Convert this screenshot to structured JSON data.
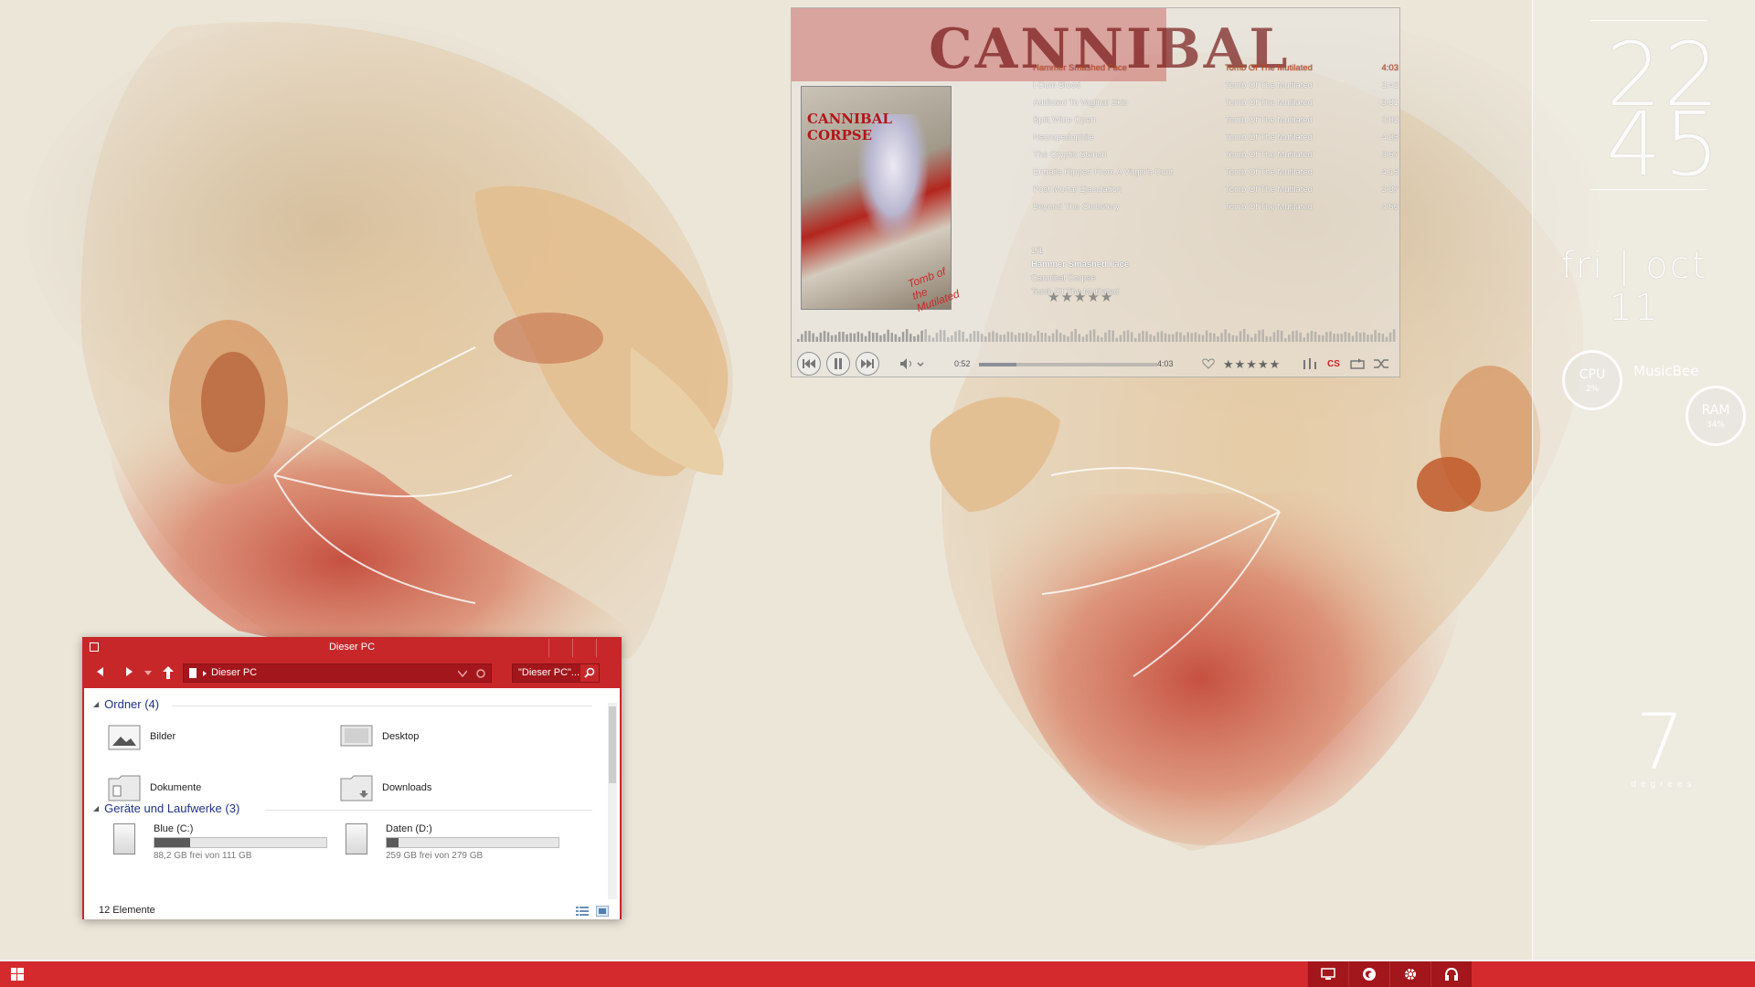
{
  "desktop": {
    "clock": {
      "hour": "22",
      "minute": "45"
    },
    "date": "fri | oct 11",
    "cpu": {
      "label": "CPU",
      "value": "2%"
    },
    "ram": {
      "label": "RAM",
      "value": "34%"
    },
    "musicbee_label": "MusicBee",
    "temperature": {
      "value": "7",
      "unit": "degrees"
    }
  },
  "player": {
    "banner_text": "CANNIBAL",
    "album_logo": "CANNIBAL CORPSE",
    "album_cover_title": "Tomb of the Mutilated",
    "tracks": [
      {
        "title": "Hammer Smashed Face",
        "album": "Tomb Of The Mutilated",
        "time": "4:03",
        "playing": true
      },
      {
        "title": "I Cum Blood",
        "album": "Tomb Of The Mutilated",
        "time": "3:42",
        "playing": false
      },
      {
        "title": "Addicted To Vaginal Skin",
        "album": "Tomb Of The Mutilated",
        "time": "3:31",
        "playing": false
      },
      {
        "title": "Split Wide Open",
        "album": "Tomb Of The Mutilated",
        "time": "3:02",
        "playing": false
      },
      {
        "title": "Necropedophile",
        "album": "Tomb Of The Mutilated",
        "time": "4:05",
        "playing": false
      },
      {
        "title": "The Cryptic Stench",
        "album": "Tomb Of The Mutilated",
        "time": "3:57",
        "playing": false
      },
      {
        "title": "Entrails Ripped From A Virgin's Cunt",
        "album": "Tomb Of The Mutilated",
        "time": "4:15",
        "playing": false
      },
      {
        "title": "Post Mortal Ejaculation",
        "album": "Tomb Of The Mutilated",
        "time": "3:37",
        "playing": false
      },
      {
        "title": "Beyond The Cemetery",
        "album": "Tomb Of The Mutilated",
        "time": "4:56",
        "playing": false
      }
    ],
    "now_playing": {
      "index": "1/1",
      "title": "Hammer Smashed Face",
      "artist": "Cannibal Corpse",
      "album": "Tomb Of The Mutilated",
      "rating": "★★★★★"
    },
    "elapsed": "0:52",
    "total": "4:03",
    "progress": 0.21,
    "control_rating": "★★★★★",
    "cs_label": "CS"
  },
  "explorer": {
    "title": "Dieser PC",
    "address": "Dieser PC",
    "search_placeholder": "\"Dieser PC\"...",
    "folders_group": "Ordner (4)",
    "folders": [
      {
        "name": "Bilder",
        "icon": "pictures-folder-icon"
      },
      {
        "name": "Desktop",
        "icon": "desktop-folder-icon"
      },
      {
        "name": "Dokumente",
        "icon": "documents-folder-icon"
      },
      {
        "name": "Downloads",
        "icon": "downloads-folder-icon"
      }
    ],
    "drives_group": "Geräte und Laufwerke (3)",
    "drives": [
      {
        "name": "Blue (C:)",
        "free": "88,2 GB frei von 111 GB",
        "used_fraction": 0.21
      },
      {
        "name": "Daten (D:)",
        "free": "259 GB frei von 279 GB",
        "used_fraction": 0.07
      }
    ],
    "status": "12 Elemente"
  },
  "colors": {
    "accent": "#c8272a",
    "accent_dark": "#a3161b",
    "taskbar": "#d42a2e"
  }
}
